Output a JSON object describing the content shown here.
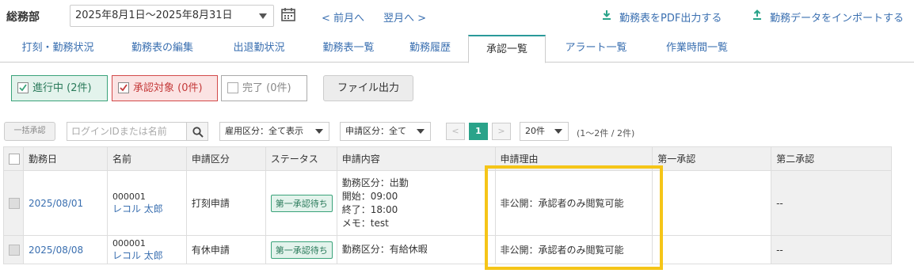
{
  "header": {
    "department": "総務部",
    "period": "2025年8月1日〜2025年8月31日",
    "prev_month": "< 前月へ",
    "next_month": "翌月へ >",
    "export_pdf": "勤務表をPDF出力する",
    "import_data": "勤務データをインポートする"
  },
  "tabs": [
    {
      "label": "打刻・勤務状況",
      "active": false
    },
    {
      "label": "勤務表の編集",
      "active": false
    },
    {
      "label": "出退勤状況",
      "active": false
    },
    {
      "label": "勤務表一覧",
      "active": false
    },
    {
      "label": "勤務履歴",
      "active": false
    },
    {
      "label": "承認一覧",
      "active": true
    },
    {
      "label": "アラート一覧",
      "active": false
    },
    {
      "label": "作業時間一覧",
      "active": false
    }
  ],
  "filters": {
    "in_progress": {
      "label": "進行中 (2件)",
      "checked": true
    },
    "approval_target": {
      "label": "承認対象 (0件)",
      "checked": true
    },
    "completed": {
      "label": "完了 (0件)",
      "checked": false
    },
    "file_export": "ファイル出力"
  },
  "toolbar": {
    "bulk_approve": "一括承認",
    "search_placeholder": "ログインIDまたは名前",
    "employment_filter": "雇用区分：全て表示",
    "request_filter": "申請区分：全て",
    "page_prev": "<",
    "page_current": "1",
    "page_next": ">",
    "per_page": "20件",
    "count_text": "(1〜2件 / 2件)"
  },
  "table": {
    "headers": [
      "勤務日",
      "名前",
      "申請区分",
      "ステータス",
      "申請内容",
      "申請理由",
      "第一承認",
      "第二承認"
    ],
    "rows": [
      {
        "date": "2025/08/01",
        "emp_id": "000001",
        "emp_name": "レコル 太郎",
        "request_type": "打刻申請",
        "status": "第一承認待ち",
        "content": [
          "勤務区分：出勤",
          "開始：09:00",
          "終了：18:00",
          "メモ：test"
        ],
        "reason": "非公開：承認者のみ閲覧可能",
        "first_approval": "",
        "second_approval": "--"
      },
      {
        "date": "2025/08/08",
        "emp_id": "000001",
        "emp_name": "レコル 太郎",
        "request_type": "有休申請",
        "status": "第一承認待ち",
        "content": [
          "勤務区分：有給休暇"
        ],
        "reason": "非公開：承認者のみ閲覧可能",
        "first_approval": "",
        "second_approval": "--"
      }
    ]
  },
  "colors": {
    "link": "#3a6fb0",
    "accent": "#2aa38a",
    "highlight": "#f5c518"
  }
}
